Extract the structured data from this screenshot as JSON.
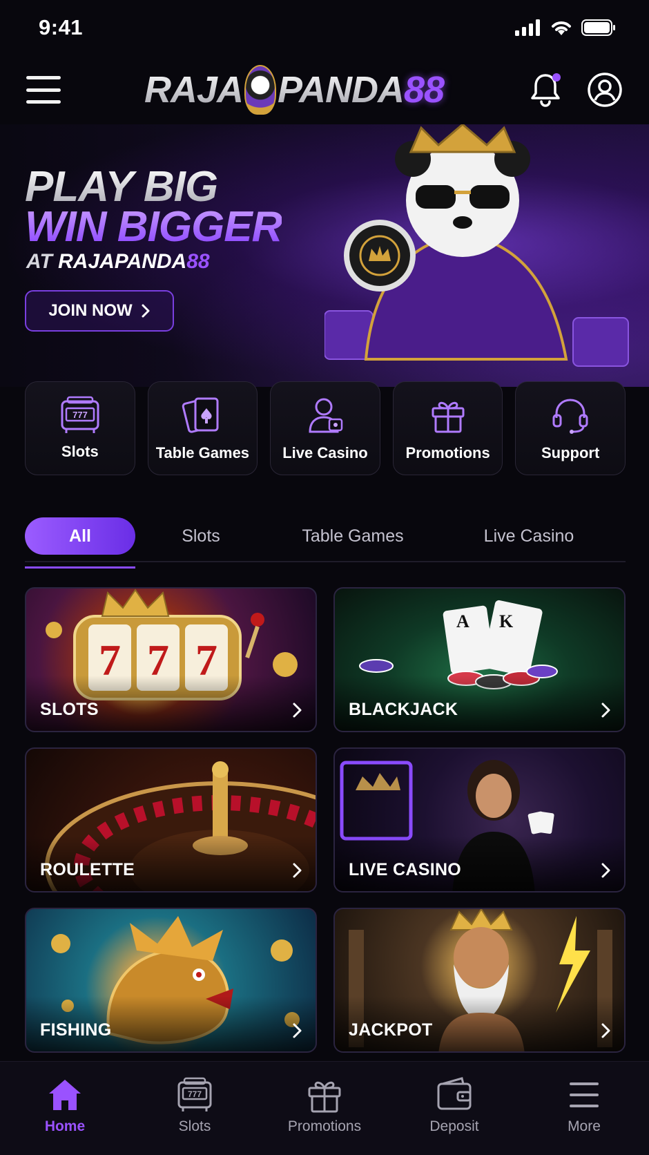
{
  "status_bar": {
    "time": "9:41"
  },
  "header": {
    "logo_part1": "RAJA",
    "logo_part2": "PANDA",
    "logo_part3": "88"
  },
  "hero": {
    "line1": "PLAY BIG",
    "line2": "WIN BIGGER",
    "sub_at": "AT",
    "sub_brand": "RAJAPANDA",
    "sub_num": "88",
    "join_label": "JOIN NOW"
  },
  "quick_categories": [
    {
      "label": "Slots",
      "icon": "slot-machine-icon"
    },
    {
      "label": "Table Games",
      "icon": "playing-card-icon"
    },
    {
      "label": "Live Casino",
      "icon": "dealer-icon"
    },
    {
      "label": "Promotions",
      "icon": "gift-icon"
    },
    {
      "label": "Support",
      "icon": "headset-icon"
    }
  ],
  "filter_tabs": [
    {
      "label": "All",
      "active": true
    },
    {
      "label": "Slots",
      "active": false
    },
    {
      "label": "Table Games",
      "active": false
    },
    {
      "label": "Live Casino",
      "active": false
    }
  ],
  "games": [
    {
      "title": "SLOTS"
    },
    {
      "title": "BLACKJACK"
    },
    {
      "title": "ROULETTE"
    },
    {
      "title": "LIVE CASINO"
    },
    {
      "title": "FISHING"
    },
    {
      "title": "JACKPOT"
    }
  ],
  "bottom_nav": [
    {
      "label": "Home",
      "icon": "home-icon",
      "active": true
    },
    {
      "label": "Slots",
      "icon": "slot-machine-icon",
      "active": false
    },
    {
      "label": "Promotions",
      "icon": "gift-icon",
      "active": false
    },
    {
      "label": "Deposit",
      "icon": "wallet-icon",
      "active": false
    },
    {
      "label": "More",
      "icon": "menu-icon",
      "active": false
    }
  ],
  "colors": {
    "accent": "#9a52ff",
    "background": "#08070d",
    "card_border": "#2a2636"
  }
}
